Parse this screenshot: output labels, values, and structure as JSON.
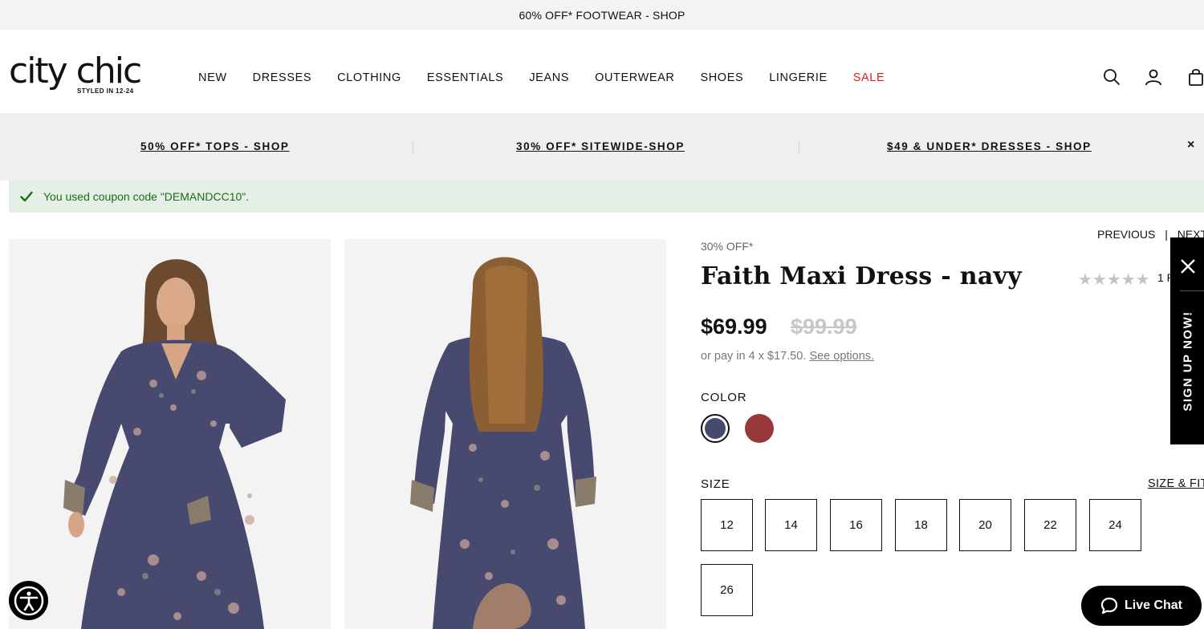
{
  "announcement": {
    "text": "60% OFF* FOOTWEAR - SHOP"
  },
  "header": {
    "logo_text": "city chic",
    "logo_tagline": "STYLED IN 12-24",
    "nav": [
      "NEW",
      "DRESSES",
      "CLOTHING",
      "ESSENTIALS",
      "JEANS",
      "OUTERWEAR",
      "SHOES",
      "LINGERIE",
      "SALE"
    ],
    "icons": [
      "search-icon",
      "account-icon",
      "bag-icon"
    ]
  },
  "promo": {
    "links": [
      "50% OFF* TOPS - SHOP",
      "30% OFF* SITEWIDE-SHOP",
      "$49 & UNDER* DRESSES - SHOP"
    ],
    "close": "×"
  },
  "coupon": {
    "message": "You used coupon code \"DEMANDCC10\"."
  },
  "product": {
    "offer": "30% OFF*",
    "previous": "PREVIOUS",
    "separator": "|",
    "next": "NEXT",
    "title": "Faith Maxi Dress - navy",
    "stars": "★★★★★",
    "review_count": "1 R",
    "rating": 0,
    "price": "$69.99",
    "was_price": "$99.99",
    "pay_later": "or pay in 4 x $17.50.",
    "pay_later_link": "See options.",
    "color_label": "COLOR",
    "colors": [
      {
        "name": "navy",
        "hex": "#474a6e",
        "selected": true
      },
      {
        "name": "red",
        "hex": "#97383a",
        "selected": false
      }
    ],
    "size_label": "SIZE",
    "size_fit": "SIZE & FIT",
    "sizes": [
      "12",
      "14",
      "16",
      "18",
      "20",
      "22",
      "24",
      "26"
    ]
  },
  "signup": {
    "label": "SIGN UP NOW!"
  },
  "live_chat": {
    "label": "Live Chat"
  },
  "colors": {
    "sale": "#e41b23",
    "coupon_bg": "#e5efe5",
    "coupon_text": "#1b6b1b",
    "dress": "#474a6e"
  }
}
